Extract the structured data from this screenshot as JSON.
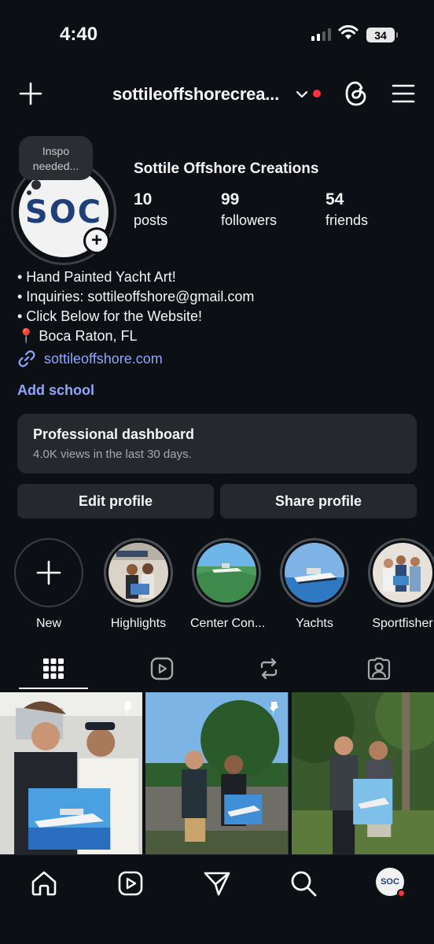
{
  "status_bar": {
    "time": "4:40",
    "battery": "34"
  },
  "header": {
    "username": "sottileoffshorecrea...",
    "notification_color": "#ff3040"
  },
  "profile": {
    "note": "Inspo needed...",
    "avatar_text": "SOC",
    "display_name": "Sottile Offshore Creations",
    "stats": [
      {
        "value": "10",
        "label": "posts"
      },
      {
        "value": "99",
        "label": "followers"
      },
      {
        "value": "54",
        "label": "friends"
      }
    ],
    "bio": [
      "• Hand Painted Yacht Art!",
      "• Inquiries: sottileoffshore@gmail.com",
      "• Click Below for the Website!",
      "📍 Boca Raton, FL"
    ],
    "link": "sottileoffshore.com",
    "add_school": "Add school",
    "link_color": "#8fa6ff"
  },
  "dashboard": {
    "title": "Professional dashboard",
    "subtitle": "4.0K views in the last 30 days."
  },
  "buttons": {
    "edit": "Edit profile",
    "share": "Share profile"
  },
  "highlights": [
    {
      "label": "New",
      "icon": "plus-icon"
    },
    {
      "label": "Highlights"
    },
    {
      "label": "Center Con..."
    },
    {
      "label": "Yachts"
    },
    {
      "label": "Sportfisher"
    }
  ],
  "tabs": [
    "grid-icon",
    "reels-icon",
    "reposts-icon",
    "tagged-icon"
  ],
  "bottom_nav": [
    "home-icon",
    "reels-icon",
    "messages-icon",
    "search-icon",
    "profile-avatar"
  ],
  "bottom_avatar_text": "SOC"
}
